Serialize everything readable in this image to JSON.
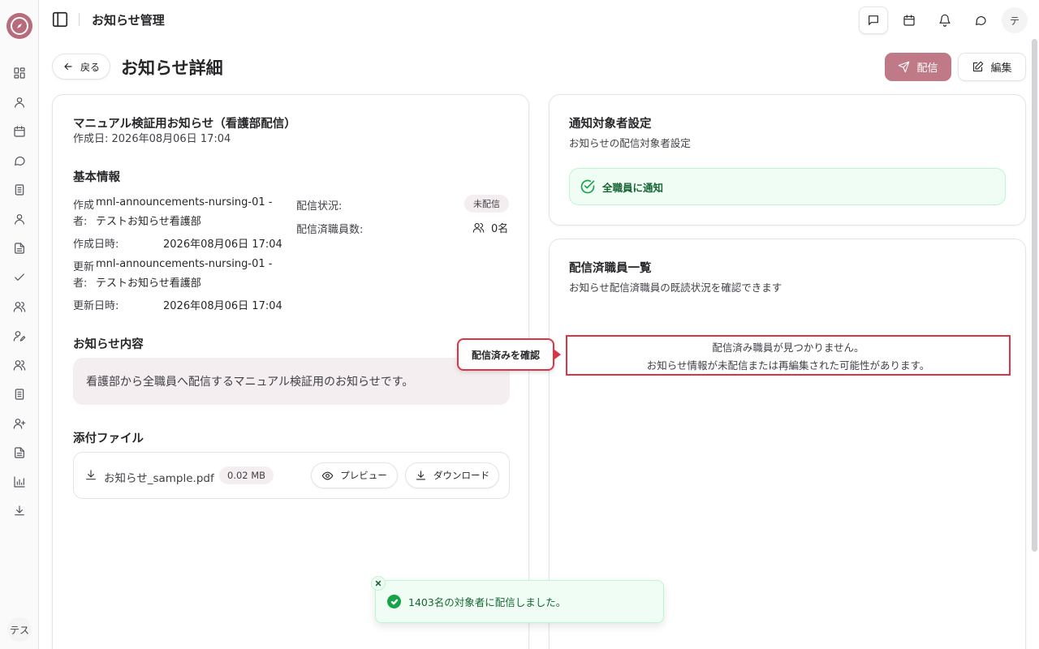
{
  "app": {
    "title": "お知らせ管理",
    "user_initial": "テ",
    "rail_user": "テス",
    "brand_color": "#b86b7a"
  },
  "rail": {
    "items": [
      "dashboard-icon",
      "user-icon",
      "calendar-icon",
      "chat-icon",
      "document-icon",
      "profile-icon",
      "file-icon",
      "check-icon",
      "users-icon",
      "user-edit-icon",
      "group-icon",
      "list-icon",
      "user-plus-icon",
      "report-icon",
      "chart-icon",
      "download-icon"
    ]
  },
  "topbar": {
    "icons": [
      "message-square-icon",
      "calendar-icon",
      "bell-icon",
      "chat-bubble-icon"
    ]
  },
  "header": {
    "back_label": "戻る",
    "page_title": "お知らせ詳細",
    "send_label": "配信",
    "edit_label": "編集",
    "send_color": "#c07a87"
  },
  "announcement": {
    "title": "マニュアル検証用お知らせ（看護部配信）",
    "created_line": "作成日: 2026年08月06日 17:04",
    "basic_info_heading": "基本情報",
    "fields": {
      "creator_label_1": "作成",
      "creator_label_2": "者:",
      "creator_value_1": "mnl-announcements-nursing-01 -",
      "creator_value_2": "テストお知らせ看護部",
      "created_at_label": "作成日時:",
      "created_at_value": "2026年08月06日 17:04",
      "updater_label_1": "更新",
      "updater_label_2": "者:",
      "updater_value_1": "mnl-announcements-nursing-01 -",
      "updater_value_2": "テストお知らせ看護部",
      "updated_at_label": "更新日時:",
      "updated_at_value": "2026年08月06日 17:04",
      "status_label": "配信状況:",
      "status_value": "未配信",
      "delivered_label": "配信済職員数:",
      "delivered_value": "0名"
    },
    "content_heading": "お知らせ内容",
    "content_text": "看護部から全職員へ配信するマニュアル検証用のお知らせです。",
    "attachments_heading": "添付ファイル",
    "attachment": {
      "name": "お知らせ_sample.pdf",
      "size": "0.02 MB",
      "preview_label": "プレビュー",
      "download_label": "ダウンロード"
    }
  },
  "target": {
    "heading": "通知対象者設定",
    "subtitle": "お知らせの配信対象者設定",
    "all_staff_label": "全職員に通知",
    "success_color": "#16a34a"
  },
  "delivered_list": {
    "heading": "配信済職員一覧",
    "subtitle": "お知らせ配信済職員の既読状況を確認できます",
    "empty_line_1": "配信済み職員が見つかりません。",
    "empty_line_2": "お知らせ情報が未配信または再編集された可能性があります。"
  },
  "callout": {
    "label": "配信済みを確認",
    "color": "#dc3545"
  },
  "toast": {
    "message": "1403名の対象者に配信しました。"
  }
}
